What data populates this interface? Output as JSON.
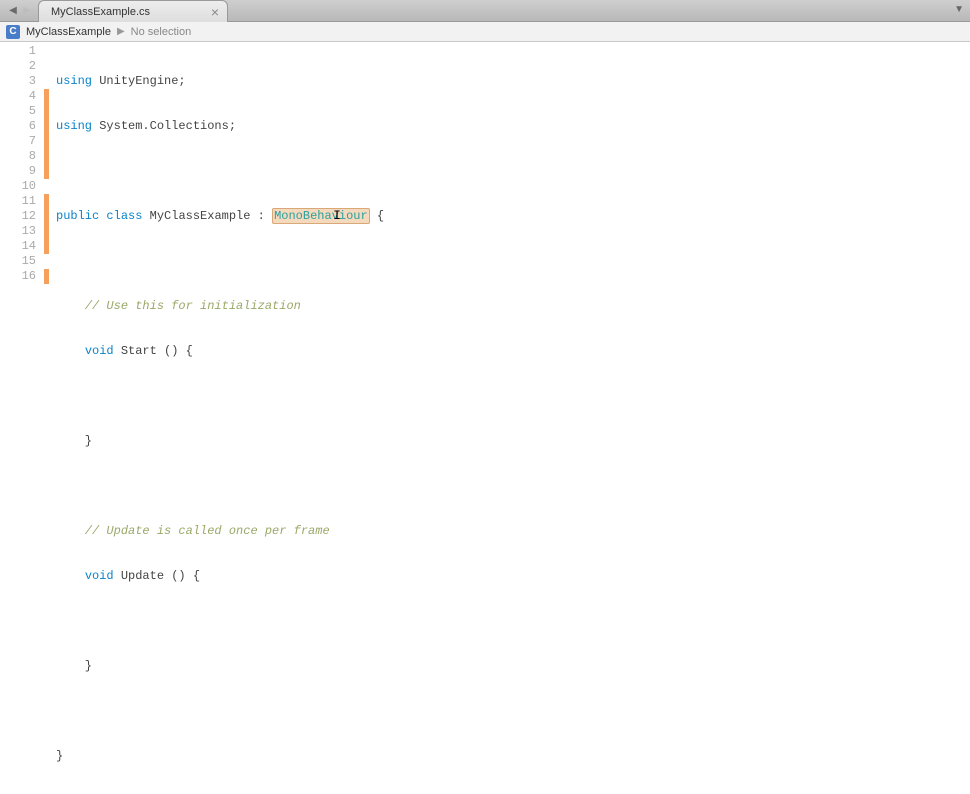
{
  "tab": {
    "title": "MyClassExample.cs"
  },
  "breadcrumb": {
    "icon_letter": "C",
    "item": "MyClassExample",
    "selection": "No selection"
  },
  "gutter": {
    "lines": [
      "1",
      "2",
      "3",
      "4",
      "5",
      "6",
      "7",
      "8",
      "9",
      "10",
      "11",
      "12",
      "13",
      "14",
      "15",
      "16"
    ]
  },
  "code": {
    "l1a": "using",
    "l1b": " UnityEngine;",
    "l2a": "using",
    "l2b": " System.Collections;",
    "l3": "",
    "l4a": "public",
    "l4b": " ",
    "l4c": "class",
    "l4d": " MyClassExample : ",
    "l4e": "MonoBehaviour",
    "l4f": " {",
    "l5": "",
    "l6a": "    ",
    "l6b": "// Use this for initialization",
    "l7a": "    ",
    "l7b": "void",
    "l7c": " Start () {",
    "l8": "    ",
    "l9": "    }",
    "l10": "",
    "l11a": "    ",
    "l11b": "// Update is called once per frame",
    "l12a": "    ",
    "l12b": "void",
    "l12c": " Update () {",
    "l13": "    ",
    "l14": "    }",
    "l15": "    ",
    "l16": "}"
  }
}
